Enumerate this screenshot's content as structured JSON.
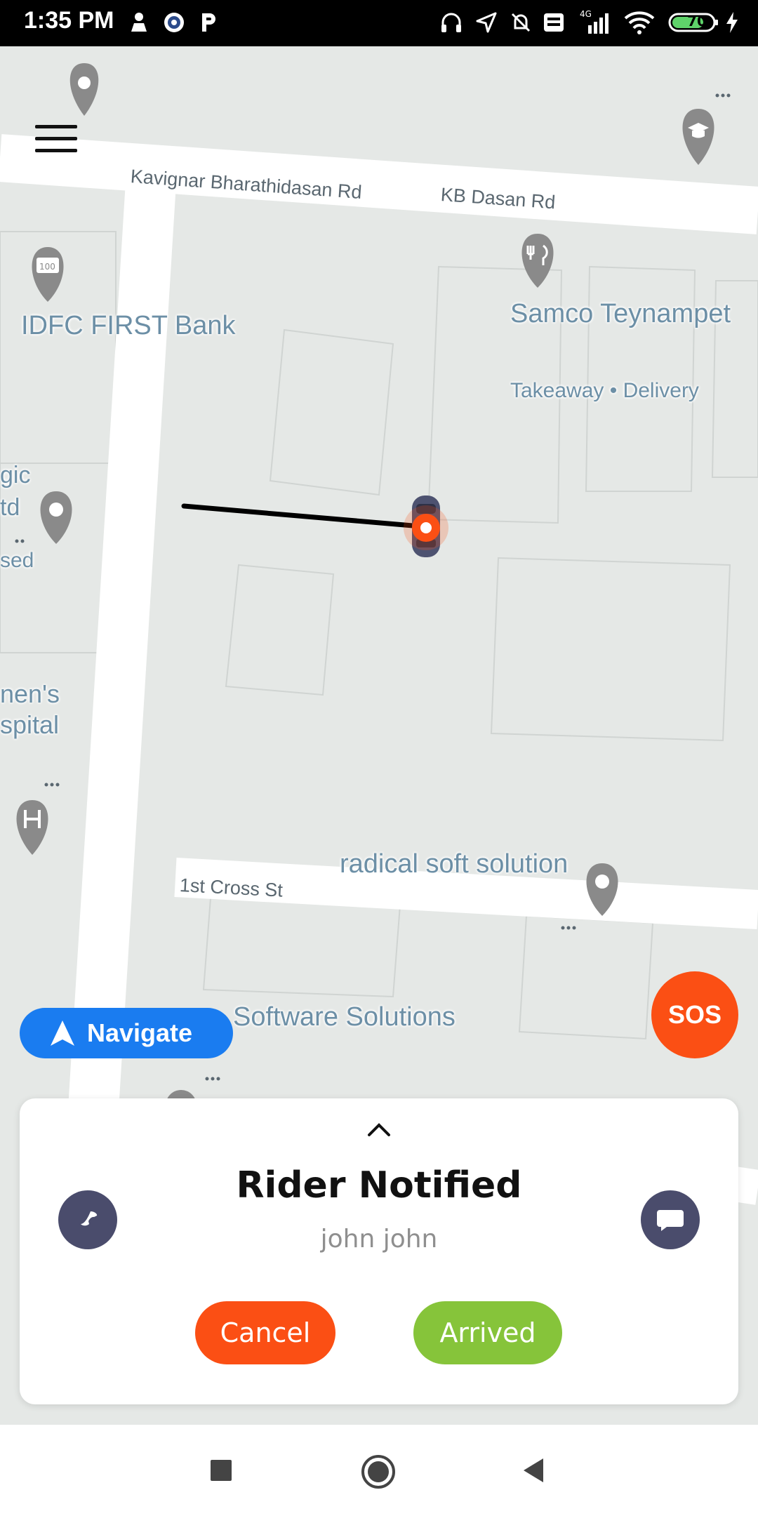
{
  "status_bar": {
    "time": "1:35 PM",
    "battery": "70",
    "network": "4G"
  },
  "map": {
    "road_labels": {
      "kavignar": "Kavignar Bharathidasan Rd",
      "kb_dasan": "KB Dasan Rd",
      "first_cross": "1st Cross St"
    },
    "poi_labels": {
      "idfc": "IDFC FIRST Bank",
      "samco": "Samco Teynampet",
      "takeaway": "Takeaway • Delivery",
      "gic_1": "gic",
      "gic_2": "td",
      "gic_3": "sed",
      "hospital_1": "nen's",
      "hospital_2": "spital",
      "radical": "radical soft solution",
      "software": "Software Solutions"
    }
  },
  "navigate": {
    "label": "Navigate"
  },
  "sos": {
    "label": "SOS"
  },
  "card": {
    "title": "Rider Notified",
    "rider_name": "john john",
    "cancel_label": "Cancel",
    "arrived_label": "Arrived"
  },
  "colors": {
    "accent_orange": "#fb4f14",
    "arrived_green": "#86c43a",
    "navigate_blue": "#1a7cf0",
    "icon_button": "#4a4c6c"
  }
}
